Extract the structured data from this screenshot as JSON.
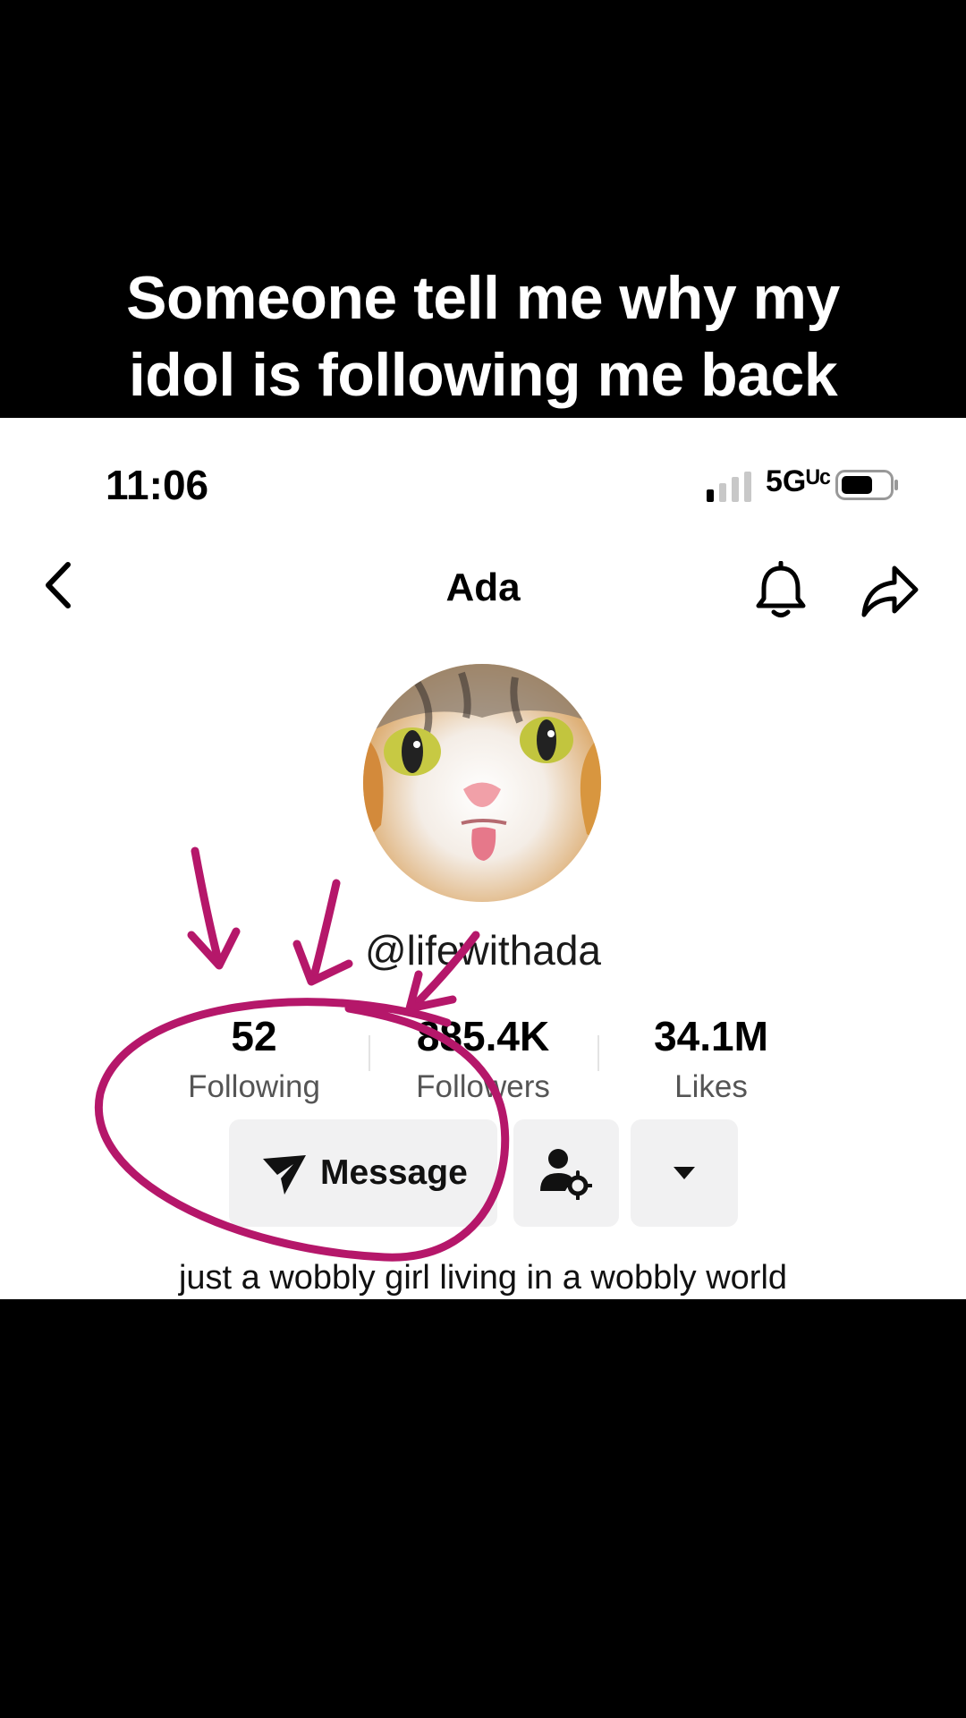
{
  "caption": {
    "line1": "Someone tell me why my",
    "line2": "idol is following me back"
  },
  "status_bar": {
    "time": "11:06",
    "network": "5Gᵁᶜ"
  },
  "header": {
    "title": "Ada"
  },
  "profile": {
    "handle": "@lifewithada",
    "bio": "just a wobbly girl living in a wobbly world",
    "stats": [
      {
        "value": "52",
        "label": "Following"
      },
      {
        "value": "885.4K",
        "label": "Followers"
      },
      {
        "value": "34.1M",
        "label": "Likes"
      }
    ]
  },
  "actions": {
    "message_label": "Message"
  },
  "icons": {
    "back": "chevron-left-icon",
    "bell": "bell-icon",
    "share": "share-arrow-icon",
    "message": "send-icon",
    "friend": "user-settings-icon",
    "more": "caret-down-icon"
  },
  "colors": {
    "annotation": "#b5176a",
    "button_bg": "#f1f1f2"
  }
}
